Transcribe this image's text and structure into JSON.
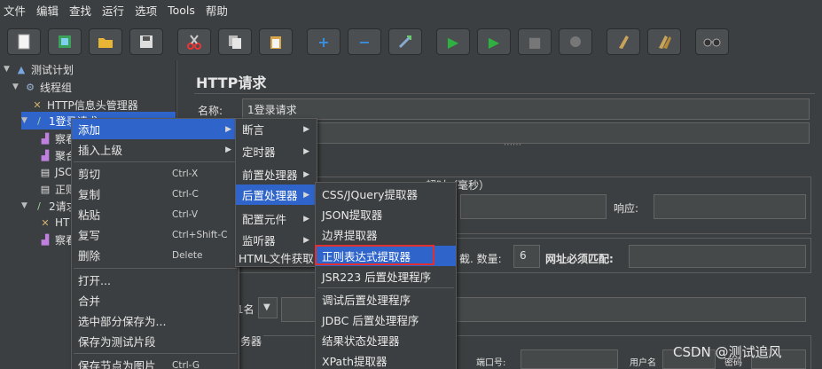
{
  "menubar": {
    "items": [
      "文件",
      "编辑",
      "查找",
      "运行",
      "选项",
      "Tools",
      "帮助"
    ]
  },
  "toolbar": {
    "icons": [
      "new-icon",
      "templates-icon",
      "open-icon",
      "save-icon",
      "cut-icon",
      "copy-icon",
      "paste-icon",
      "expand-icon",
      "collapse-icon",
      "toggle-icon",
      "start-icon",
      "start-no-pause-icon",
      "stop-icon",
      "shutdown-icon",
      "clear-icon",
      "clear-all-icon",
      "search-icon"
    ],
    "glyphs": {
      "add": "+",
      "remove": "−",
      "start": "▶",
      "stop": "■"
    }
  },
  "tree": {
    "test_plan": "测试计划",
    "thread_group": "线程组",
    "header_manager": "HTTP信息头管理器",
    "login_request": "1登录请求",
    "child_a": "察看",
    "child_b": "聚合",
    "child_c": "JSO",
    "child_d": "正则",
    "request_2": "2请求",
    "child_e": "HT",
    "child_f": "察看"
  },
  "panel": {
    "title": "HTTP请求",
    "name_label": "名称:",
    "name_value": "1登录请求",
    "timeout_group": "超时（毫秒）",
    "response_label": "响应:",
    "pool_label": "截. 数量:",
    "pool_value": "6",
    "must_match_label": "网址必须匹配:",
    "name_fragment": "1名",
    "server_fragment": "务器",
    "port_label": "端口号:",
    "user_label": "用户名",
    "password_label": "密码"
  },
  "menu1": {
    "items": [
      {
        "label": "添加",
        "shortcut": "",
        "submenu": true
      },
      {
        "label": "插入上级",
        "shortcut": "",
        "submenu": true
      },
      {
        "label": "剪切",
        "shortcut": "Ctrl-X",
        "submenu": false
      },
      {
        "label": "复制",
        "shortcut": "Ctrl-C",
        "submenu": false
      },
      {
        "label": "粘贴",
        "shortcut": "Ctrl-V",
        "submenu": false
      },
      {
        "label": "复写",
        "shortcut": "Ctrl+Shift-C",
        "submenu": false
      },
      {
        "label": "删除",
        "shortcut": "Delete",
        "submenu": false
      },
      {
        "label": "打开...",
        "shortcut": "",
        "submenu": false
      },
      {
        "label": "合并",
        "shortcut": "",
        "submenu": false
      },
      {
        "label": "选中部分保存为...",
        "shortcut": "",
        "submenu": false
      },
      {
        "label": "保存为测试片段",
        "shortcut": "",
        "submenu": false
      },
      {
        "label": "保存节点为图片",
        "shortcut": "Ctrl-G",
        "submenu": false
      }
    ]
  },
  "menu2": {
    "items": [
      {
        "label": "断言",
        "submenu": true
      },
      {
        "label": "定时器",
        "submenu": true
      },
      {
        "label": "前置处理器",
        "submenu": true
      },
      {
        "label": "后置处理器",
        "submenu": true
      },
      {
        "label": "配置元件",
        "submenu": true
      },
      {
        "label": "监听器",
        "submenu": true
      },
      {
        "label": "HTML文件获取",
        "submenu": false
      }
    ]
  },
  "menu3": {
    "items": [
      "CSS/JQuery提取器",
      "JSON提取器",
      "边界提取器",
      "正则表达式提取器",
      "JSR223 后置处理程序",
      "调试后置处理程序",
      "JDBC 后置处理程序",
      "结果状态处理器",
      "XPath提取器"
    ]
  },
  "watermark": "CSDN @测试追风",
  "colors": {
    "highlight": "#2f65ca",
    "annotation": "#e03030",
    "background": "#3c3f41"
  }
}
